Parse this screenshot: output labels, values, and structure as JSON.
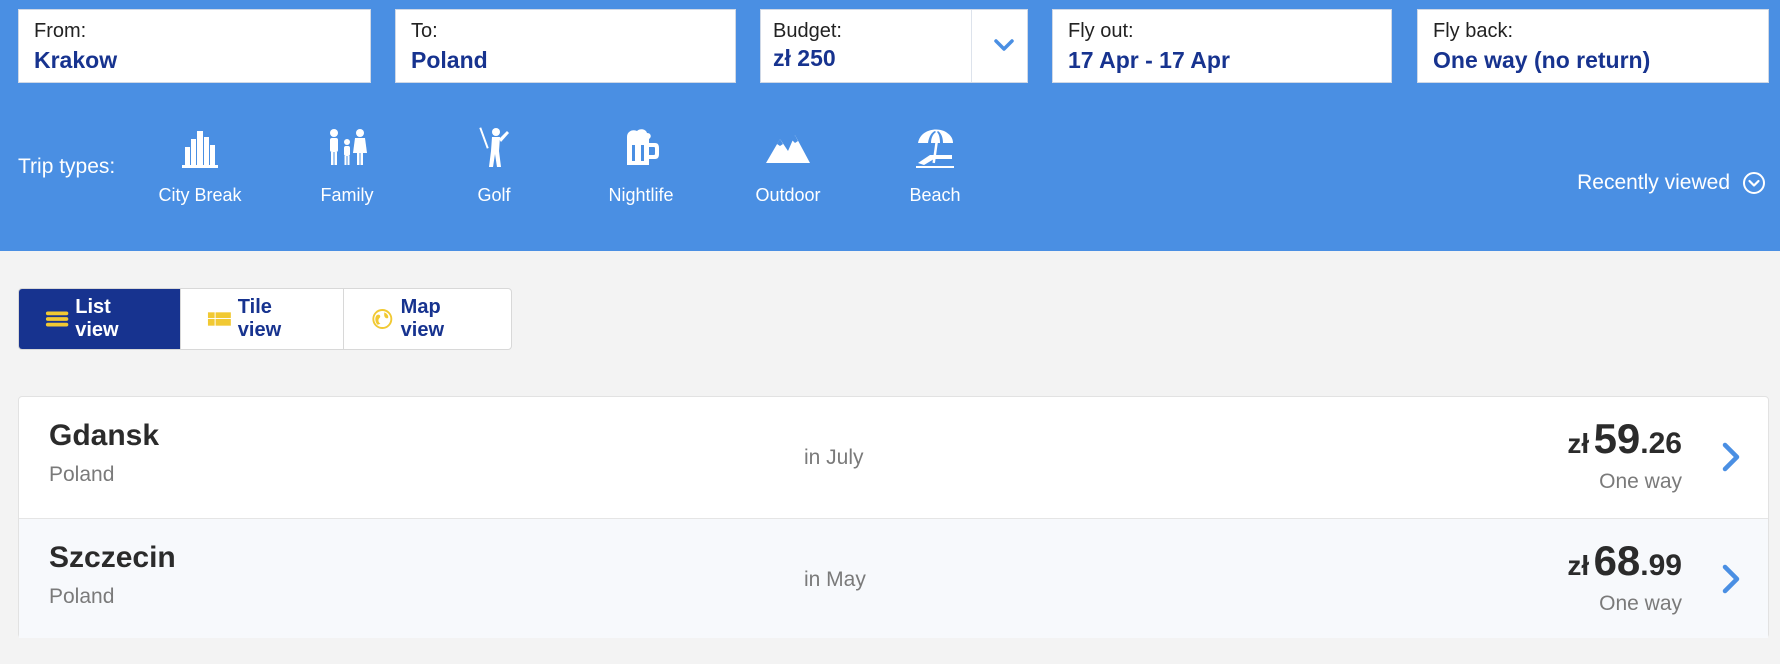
{
  "search": {
    "from": {
      "label": "From:",
      "value": "Krakow"
    },
    "to": {
      "label": "To:",
      "value": "Poland"
    },
    "budget": {
      "label": "Budget:",
      "value": "zł 250",
      "dropdown_icon": "chevron-down-icon"
    },
    "fly_out": {
      "label": "Fly out:",
      "value": "17 Apr - 17 Apr"
    },
    "fly_back": {
      "label": "Fly back:",
      "value": "One way (no return)"
    }
  },
  "trip_types": {
    "label": "Trip types:",
    "items": [
      {
        "label": "City Break",
        "icon": "city-icon"
      },
      {
        "label": "Family",
        "icon": "family-icon"
      },
      {
        "label": "Golf",
        "icon": "golf-icon"
      },
      {
        "label": "Nightlife",
        "icon": "beer-icon"
      },
      {
        "label": "Outdoor",
        "icon": "mountain-icon"
      },
      {
        "label": "Beach",
        "icon": "beach-umbrella-icon"
      }
    ]
  },
  "recently_viewed": {
    "label": "Recently viewed",
    "icon": "chevron-circle-down-icon"
  },
  "view_toggle": {
    "items": [
      {
        "label": "List view",
        "icon": "list-icon",
        "active": true
      },
      {
        "label": "Tile view",
        "icon": "tile-icon",
        "active": false
      },
      {
        "label": "Map view",
        "icon": "globe-icon",
        "active": false
      }
    ]
  },
  "results": [
    {
      "city": "Gdansk",
      "country": "Poland",
      "when": "in July",
      "currency": "zł",
      "price_int": "59",
      "price_dec": ".26",
      "trip": "One way"
    },
    {
      "city": "Szczecin",
      "country": "Poland",
      "when": "in May",
      "currency": "zł",
      "price_int": "68",
      "price_dec": ".99",
      "trip": "One way"
    }
  ],
  "colors": {
    "header_bg": "#4a8fe3",
    "brand_navy": "#17338f",
    "accent_yellow": "#f1c933",
    "page_bg": "#f3f3f3"
  }
}
